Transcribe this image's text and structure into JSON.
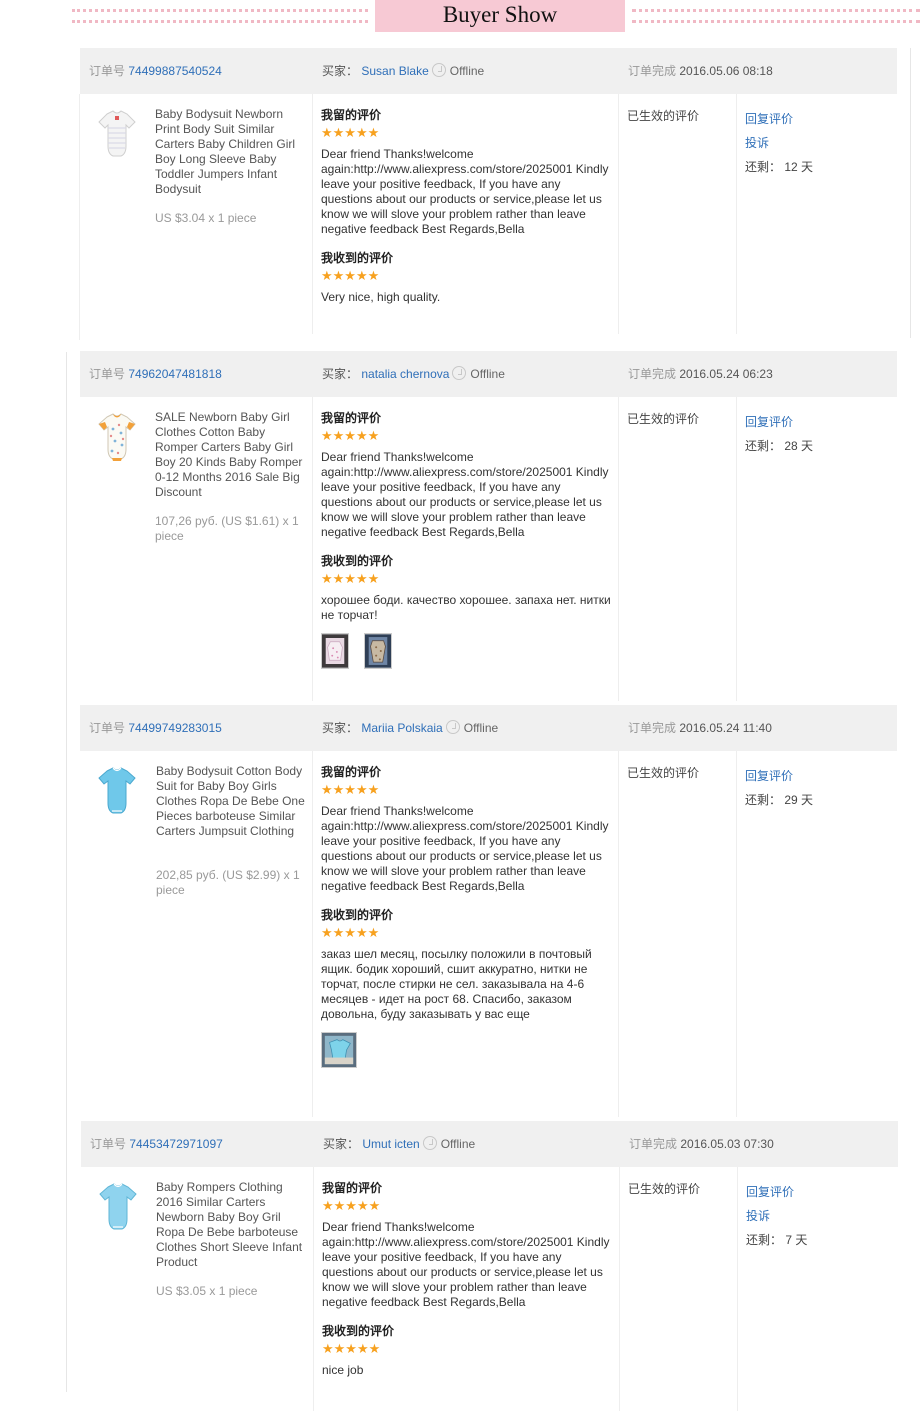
{
  "banner": {
    "title": "Buyer Show"
  },
  "labels": {
    "order_no": "订单号",
    "buyer": "买家：",
    "order_complete": "订单完成",
    "given_feedback": "我留的评价",
    "received_feedback": "我收到的评价",
    "effective": "已生效的评价",
    "reply": "回复评价",
    "complain": "投诉",
    "remaining": "还剩：",
    "offline": "Offline"
  },
  "colors": {
    "star": "#f7a11f",
    "link": "#2f6fb8",
    "banner": "#f7c9d4",
    "header_bg": "#f0f0f0"
  },
  "orders": [
    {
      "order_id": "74499887540524",
      "buyer_name": "Susan Blake",
      "completed": "2016.05.06 08:18",
      "product_title": "Baby Bodysuit Newborn Print Body Suit Similar Carters Baby Children Girl Boy Long Sleeve Baby Toddler Jumpers Infant Bodysuit",
      "product_price": "US $3.04 x 1 piece",
      "product_icon": "white-striped-bodysuit-image",
      "given_stars": "★★★★★",
      "given_text": "Dear friend Thanks!welcome again:http://www.aliexpress.com/store/2025001 Kindly leave your positive feedback, If you have any questions about our products or service,please let us know we will slove your problem rather than leave negative feedback Best Regards,Bella",
      "received_stars": "★★★★★",
      "received_text": "Very nice, high quality.",
      "remaining_days": "12 天",
      "has_complain": true
    },
    {
      "order_id": "74962047481818",
      "buyer_name": "natalia chernova",
      "completed": "2016.05.24 06:23",
      "product_title": "SALE Newborn Baby Girl Clothes Cotton Baby Romper Carters Baby Girl Boy 20 Kinds Baby Romper 0-12 Months 2016 Sale Big Discount",
      "product_price": "107,26 руб. (US $1.61) x 1 piece",
      "product_icon": "printed-romper-image",
      "given_stars": "★★★★★",
      "given_text": "Dear friend Thanks!welcome again:http://www.aliexpress.com/store/2025001 Kindly leave your positive feedback, If you have any questions about our products or service,please let us know we will slove your problem rather than leave negative feedback Best Regards,Bella",
      "received_stars": "★★★★★",
      "received_text": "хорошее боди. качество хорошее. запаха нет. нитки не торчат!",
      "remaining_days": "28 天",
      "has_complain": false
    },
    {
      "order_id": "74499749283015",
      "buyer_name": "Mariia Polskaia",
      "completed": "2016.05.24 11:40",
      "product_title": "Baby Bodysuit Cotton Body Suit for Baby Boy Girls Clothes Ropa De Bebe One Pieces barboteuse Similar Carters Jumpsuit Clothing",
      "product_price": "202,85 руб. (US $2.99) x 1 piece",
      "product_icon": "blue-bodysuit-image",
      "given_stars": "★★★★★",
      "given_text": "Dear friend Thanks!welcome again:http://www.aliexpress.com/store/2025001 Kindly leave your positive feedback, If you have any questions about our products or service,please let us know we will slove your problem rather than leave negative feedback Best Regards,Bella",
      "received_stars": "★★★★★",
      "received_text": "заказ шел месяц, посылку положили в почтовый ящик. бодик хороший, сшит аккуратно, нитки не торчат, после стирки не сел. заказывала на 4-6 месяцев - идет на рост 68. Спасибо, заказом довольна, буду заказывать у вас еще",
      "remaining_days": "29 天",
      "has_complain": false
    },
    {
      "order_id": "74453472971097",
      "buyer_name": "Umut icten",
      "completed": "2016.05.03 07:30",
      "product_title": "Baby Rompers Clothing 2016 Similar Carters Newborn Baby Boy Gril Ropa De Bebe barboteuse Clothes Short Sleeve Infant Product",
      "product_price": "US $3.05 x 1 piece",
      "product_icon": "light-blue-bodysuit-image",
      "given_stars": "★★★★★",
      "given_text": "Dear friend Thanks!welcome again:http://www.aliexpress.com/store/2025001 Kindly leave your positive feedback, If you have any questions about our products or service,please let us know we will slove your problem rather than leave negative feedback Best Regards,Bella",
      "received_stars": "★★★★★",
      "received_text": "nice job",
      "remaining_days": "7 天",
      "has_complain": true
    }
  ]
}
